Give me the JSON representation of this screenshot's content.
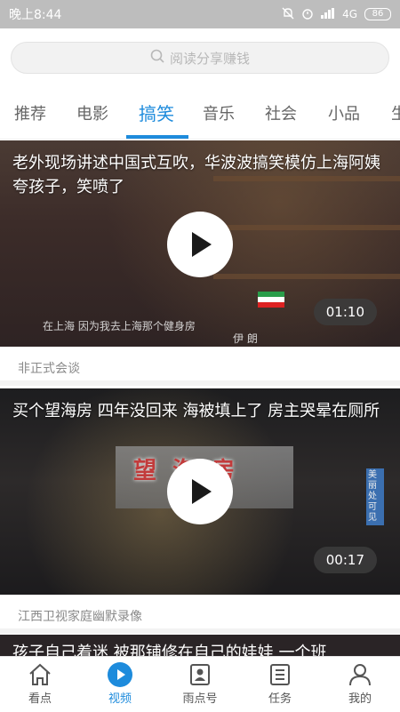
{
  "status_bar": {
    "time": "晚上8:44",
    "network": "4G",
    "battery": "86"
  },
  "search": {
    "placeholder": "阅读分享赚钱"
  },
  "tabs": [
    {
      "label": "推荐",
      "active": false
    },
    {
      "label": "电影",
      "active": false
    },
    {
      "label": "搞笑",
      "active": true
    },
    {
      "label": "音乐",
      "active": false
    },
    {
      "label": "社会",
      "active": false
    },
    {
      "label": "小品",
      "active": false
    },
    {
      "label": "生",
      "active": false
    }
  ],
  "feed": [
    {
      "title": "老外现场讲述中国式互吹，华波波搞笑模仿上海阿姨夸孩子，笑喷了",
      "duration": "01:10",
      "source": "非正式会谈",
      "video_caption": "在上海 因为我去上海那个健身房",
      "name_tag": "伊 朗"
    },
    {
      "title": "买个望海房 四年没回来 海被填上了 房主哭晕在厕所",
      "duration": "00:17",
      "source": "江西卫视家庭幽默录像",
      "video_caption": "望海房",
      "side_text": "美丽处可见"
    },
    {
      "title": "孩子自己着迷 被那铺修在自己的娃娃 一个班"
    }
  ],
  "bottom_nav": [
    {
      "label": "看点",
      "icon": "home-icon",
      "active": false
    },
    {
      "label": "视频",
      "icon": "video-play-icon",
      "active": true
    },
    {
      "label": "雨点号",
      "icon": "contact-card-icon",
      "active": false
    },
    {
      "label": "任务",
      "icon": "task-list-icon",
      "active": false
    },
    {
      "label": "我的",
      "icon": "person-icon",
      "active": false
    }
  ],
  "colors": {
    "accent": "#1d8bdc",
    "status_bar": "#bdbdbd"
  }
}
